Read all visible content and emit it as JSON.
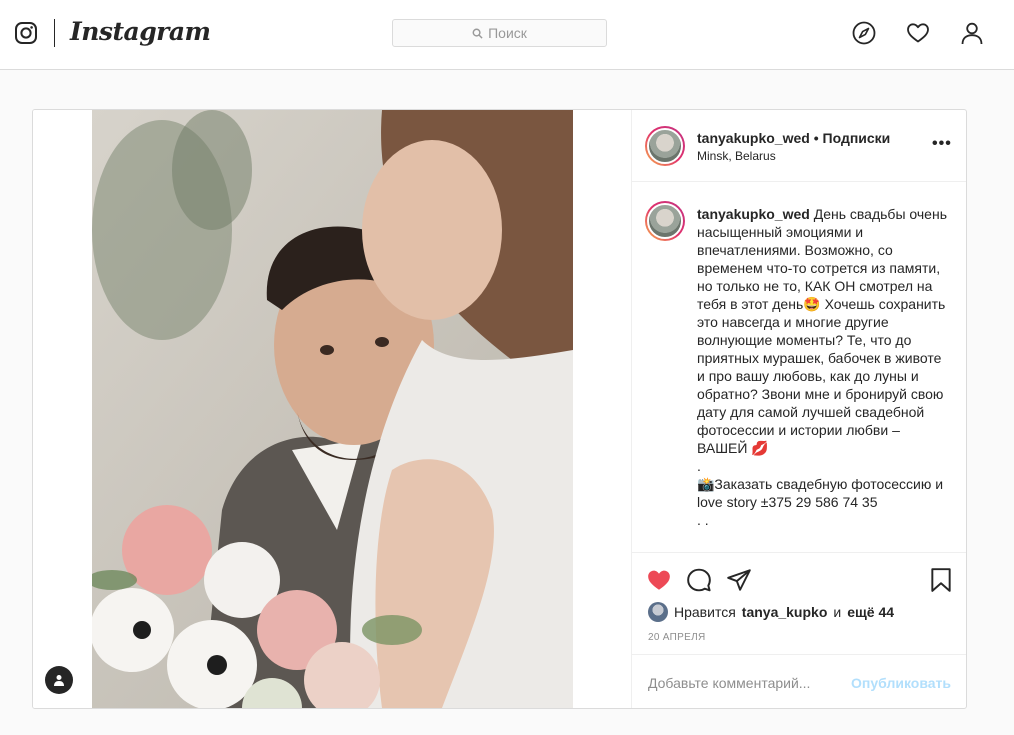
{
  "header": {
    "brand": "Instagram",
    "search_placeholder": "Поиск"
  },
  "post": {
    "author": "tanyakupko_wed",
    "follow_label": "• Подписки",
    "location": "Minsk, Belarus",
    "more_label": "•••",
    "caption_author": "tanyakupko_wed",
    "caption": " День свадьбы очень насыщенный эмоциями и впечатлениями. Возможно, со временем что-то сотрется из памяти, но только не то, КАК ОН смотрел на тебя в этот день🤩 Хочешь сохранить это навсегда и многие другие волнующие моменты? Те, что до приятных мурашек, бабочек в животе и про вашу любовь, как до луны и обратно? Звони мне и бронируй свою дату для самой лучшей свадебной фотосессии и истории любви – ВАШЕЙ 💋\n.\n📸Заказать свадебную фотосессию и love story ±375 29 586 74 35\n. .",
    "likes_prefix": "Нравится",
    "likes_user": "tanya_kupko",
    "likes_and": "и",
    "likes_more": "ещё 44",
    "date": "20 АПРЕЛЯ",
    "comment_placeholder": "Добавьте комментарий...",
    "publish_label": "Опубликовать",
    "liked": true
  },
  "colors": {
    "like_red": "#ed4956",
    "publish_blue": "#b2dffc"
  }
}
